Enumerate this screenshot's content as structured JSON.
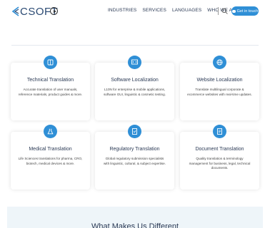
{
  "header": {
    "logo_text": "CSOFT",
    "nav": [
      "INDUSTRIES",
      "SERVICES",
      "LANGUAGES",
      "WHO WE ARE"
    ],
    "cta_label": "Get in touch"
  },
  "cards": [
    {
      "title": "Technical Translation",
      "desc": "Accurate translation of user manuals, reference materials, product guides & more.",
      "icon": "book-icon"
    },
    {
      "title": "Software Localization",
      "desc": "L10N for enterprise & mobile applications, software GUI, linguistic & cosmetic testing.",
      "icon": "code-icon"
    },
    {
      "title": "Website Localization",
      "desc": "Translate multilingual corporate & ecommerce websites with real-time updates.",
      "icon": "globe-icon"
    },
    {
      "title": "Medical Translation",
      "desc": "Life Sciences translations for pharma, CRO, biotech, medical devices & more.",
      "icon": "flask-icon"
    },
    {
      "title": "Regulatory Translation",
      "desc": "Global regulatory submission specialists with linguistic, cultural, & subject expertise.",
      "icon": "document-check-icon"
    },
    {
      "title": "Document Translation",
      "desc": "Quality translation & terminology management for business, legal, technical documents.",
      "icon": "document-icon"
    }
  ],
  "bottom": {
    "title": "What Makes Us Different"
  },
  "colors": {
    "accent": "#2f8fd6",
    "brand": "#2b4a73"
  }
}
